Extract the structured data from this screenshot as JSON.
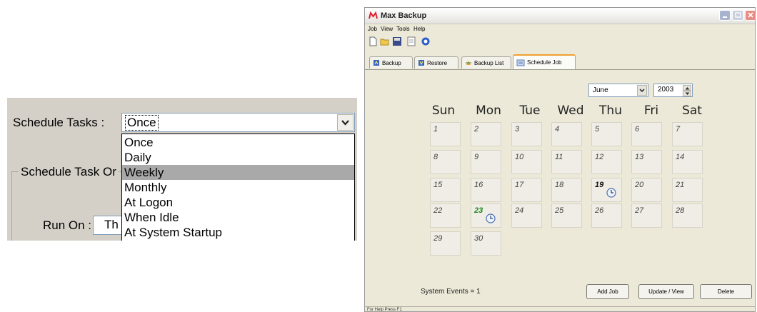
{
  "zoom_panel": {
    "schedule_label": "Schedule Tasks :",
    "combo_value": "Once",
    "group_legend": "Schedule Task Or",
    "run_on_label": "Run On :",
    "run_on_value": "Th",
    "dropdown_options": [
      "Once",
      "Daily",
      "Weekly",
      "Monthly",
      "At Logon",
      "When Idle",
      "At System Startup"
    ],
    "dropdown_highlighted": "Weekly"
  },
  "app": {
    "title": "Max Backup",
    "menu": [
      "Job",
      "View",
      "Tools",
      "Help"
    ],
    "toolbar_icons": [
      "new-icon",
      "open-icon",
      "save-icon",
      "properties-icon",
      "help-icon"
    ],
    "tabs": [
      {
        "label": "Backup",
        "icon": "backup-icon"
      },
      {
        "label": "Restore",
        "icon": "restore-icon"
      },
      {
        "label": "Backup List",
        "icon": "backup-list-icon"
      },
      {
        "label": "Schedule Job",
        "icon": "schedule-job-icon",
        "active": true
      }
    ],
    "calendar": {
      "month": "June",
      "year": "2003",
      "day_headers": [
        "Sun",
        "Mon",
        "Tue",
        "Wed",
        "Thu",
        "Fri",
        "Sat"
      ],
      "weeks": [
        [
          "1",
          "2",
          "3",
          "4",
          "5",
          "6",
          "7"
        ],
        [
          "8",
          "9",
          "10",
          "11",
          "12",
          "13",
          "14"
        ],
        [
          "15",
          "16",
          "17",
          "18",
          "19",
          "20",
          "21"
        ],
        [
          "22",
          "23",
          "24",
          "25",
          "26",
          "27",
          "28"
        ],
        [
          "29",
          "30"
        ]
      ],
      "event_days": [
        {
          "day": "19",
          "color": "#111111"
        },
        {
          "day": "23",
          "color": "#1f8a1f"
        }
      ]
    },
    "system_events": "System Events = 1",
    "buttons": {
      "add_job": "Add Job",
      "update_view": "Update / View",
      "delete": "Delete"
    },
    "status": "For Help Press F1"
  }
}
